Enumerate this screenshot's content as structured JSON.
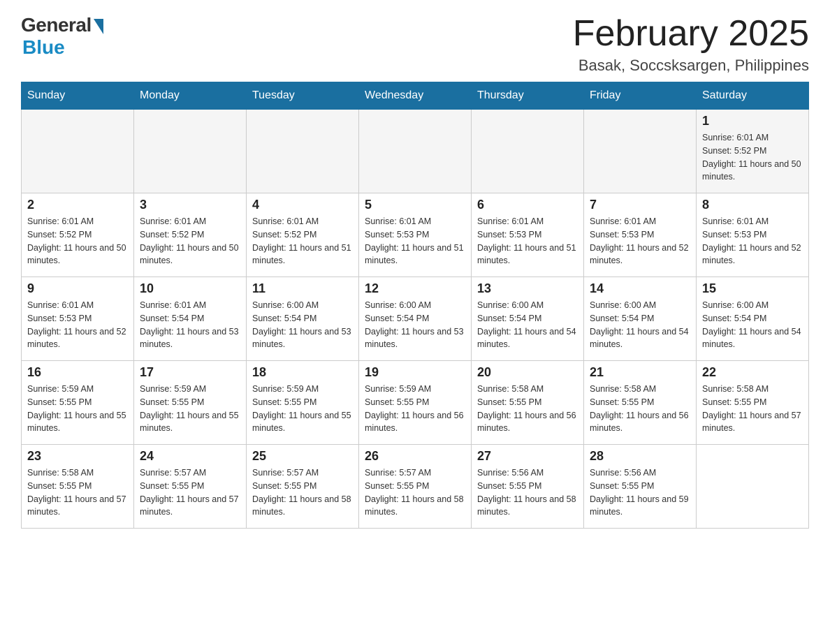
{
  "logo": {
    "general": "General",
    "blue": "Blue"
  },
  "title": "February 2025",
  "location": "Basak, Soccsksargen, Philippines",
  "weekdays": [
    "Sunday",
    "Monday",
    "Tuesday",
    "Wednesday",
    "Thursday",
    "Friday",
    "Saturday"
  ],
  "weeks": [
    [
      {
        "day": "",
        "sunrise": "",
        "sunset": "",
        "daylight": ""
      },
      {
        "day": "",
        "sunrise": "",
        "sunset": "",
        "daylight": ""
      },
      {
        "day": "",
        "sunrise": "",
        "sunset": "",
        "daylight": ""
      },
      {
        "day": "",
        "sunrise": "",
        "sunset": "",
        "daylight": ""
      },
      {
        "day": "",
        "sunrise": "",
        "sunset": "",
        "daylight": ""
      },
      {
        "day": "",
        "sunrise": "",
        "sunset": "",
        "daylight": ""
      },
      {
        "day": "1",
        "sunrise": "Sunrise: 6:01 AM",
        "sunset": "Sunset: 5:52 PM",
        "daylight": "Daylight: 11 hours and 50 minutes."
      }
    ],
    [
      {
        "day": "2",
        "sunrise": "Sunrise: 6:01 AM",
        "sunset": "Sunset: 5:52 PM",
        "daylight": "Daylight: 11 hours and 50 minutes."
      },
      {
        "day": "3",
        "sunrise": "Sunrise: 6:01 AM",
        "sunset": "Sunset: 5:52 PM",
        "daylight": "Daylight: 11 hours and 50 minutes."
      },
      {
        "day": "4",
        "sunrise": "Sunrise: 6:01 AM",
        "sunset": "Sunset: 5:52 PM",
        "daylight": "Daylight: 11 hours and 51 minutes."
      },
      {
        "day": "5",
        "sunrise": "Sunrise: 6:01 AM",
        "sunset": "Sunset: 5:53 PM",
        "daylight": "Daylight: 11 hours and 51 minutes."
      },
      {
        "day": "6",
        "sunrise": "Sunrise: 6:01 AM",
        "sunset": "Sunset: 5:53 PM",
        "daylight": "Daylight: 11 hours and 51 minutes."
      },
      {
        "day": "7",
        "sunrise": "Sunrise: 6:01 AM",
        "sunset": "Sunset: 5:53 PM",
        "daylight": "Daylight: 11 hours and 52 minutes."
      },
      {
        "day": "8",
        "sunrise": "Sunrise: 6:01 AM",
        "sunset": "Sunset: 5:53 PM",
        "daylight": "Daylight: 11 hours and 52 minutes."
      }
    ],
    [
      {
        "day": "9",
        "sunrise": "Sunrise: 6:01 AM",
        "sunset": "Sunset: 5:53 PM",
        "daylight": "Daylight: 11 hours and 52 minutes."
      },
      {
        "day": "10",
        "sunrise": "Sunrise: 6:01 AM",
        "sunset": "Sunset: 5:54 PM",
        "daylight": "Daylight: 11 hours and 53 minutes."
      },
      {
        "day": "11",
        "sunrise": "Sunrise: 6:00 AM",
        "sunset": "Sunset: 5:54 PM",
        "daylight": "Daylight: 11 hours and 53 minutes."
      },
      {
        "day": "12",
        "sunrise": "Sunrise: 6:00 AM",
        "sunset": "Sunset: 5:54 PM",
        "daylight": "Daylight: 11 hours and 53 minutes."
      },
      {
        "day": "13",
        "sunrise": "Sunrise: 6:00 AM",
        "sunset": "Sunset: 5:54 PM",
        "daylight": "Daylight: 11 hours and 54 minutes."
      },
      {
        "day": "14",
        "sunrise": "Sunrise: 6:00 AM",
        "sunset": "Sunset: 5:54 PM",
        "daylight": "Daylight: 11 hours and 54 minutes."
      },
      {
        "day": "15",
        "sunrise": "Sunrise: 6:00 AM",
        "sunset": "Sunset: 5:54 PM",
        "daylight": "Daylight: 11 hours and 54 minutes."
      }
    ],
    [
      {
        "day": "16",
        "sunrise": "Sunrise: 5:59 AM",
        "sunset": "Sunset: 5:55 PM",
        "daylight": "Daylight: 11 hours and 55 minutes."
      },
      {
        "day": "17",
        "sunrise": "Sunrise: 5:59 AM",
        "sunset": "Sunset: 5:55 PM",
        "daylight": "Daylight: 11 hours and 55 minutes."
      },
      {
        "day": "18",
        "sunrise": "Sunrise: 5:59 AM",
        "sunset": "Sunset: 5:55 PM",
        "daylight": "Daylight: 11 hours and 55 minutes."
      },
      {
        "day": "19",
        "sunrise": "Sunrise: 5:59 AM",
        "sunset": "Sunset: 5:55 PM",
        "daylight": "Daylight: 11 hours and 56 minutes."
      },
      {
        "day": "20",
        "sunrise": "Sunrise: 5:58 AM",
        "sunset": "Sunset: 5:55 PM",
        "daylight": "Daylight: 11 hours and 56 minutes."
      },
      {
        "day": "21",
        "sunrise": "Sunrise: 5:58 AM",
        "sunset": "Sunset: 5:55 PM",
        "daylight": "Daylight: 11 hours and 56 minutes."
      },
      {
        "day": "22",
        "sunrise": "Sunrise: 5:58 AM",
        "sunset": "Sunset: 5:55 PM",
        "daylight": "Daylight: 11 hours and 57 minutes."
      }
    ],
    [
      {
        "day": "23",
        "sunrise": "Sunrise: 5:58 AM",
        "sunset": "Sunset: 5:55 PM",
        "daylight": "Daylight: 11 hours and 57 minutes."
      },
      {
        "day": "24",
        "sunrise": "Sunrise: 5:57 AM",
        "sunset": "Sunset: 5:55 PM",
        "daylight": "Daylight: 11 hours and 57 minutes."
      },
      {
        "day": "25",
        "sunrise": "Sunrise: 5:57 AM",
        "sunset": "Sunset: 5:55 PM",
        "daylight": "Daylight: 11 hours and 58 minutes."
      },
      {
        "day": "26",
        "sunrise": "Sunrise: 5:57 AM",
        "sunset": "Sunset: 5:55 PM",
        "daylight": "Daylight: 11 hours and 58 minutes."
      },
      {
        "day": "27",
        "sunrise": "Sunrise: 5:56 AM",
        "sunset": "Sunset: 5:55 PM",
        "daylight": "Daylight: 11 hours and 58 minutes."
      },
      {
        "day": "28",
        "sunrise": "Sunrise: 5:56 AM",
        "sunset": "Sunset: 5:55 PM",
        "daylight": "Daylight: 11 hours and 59 minutes."
      },
      {
        "day": "",
        "sunrise": "",
        "sunset": "",
        "daylight": ""
      }
    ]
  ]
}
